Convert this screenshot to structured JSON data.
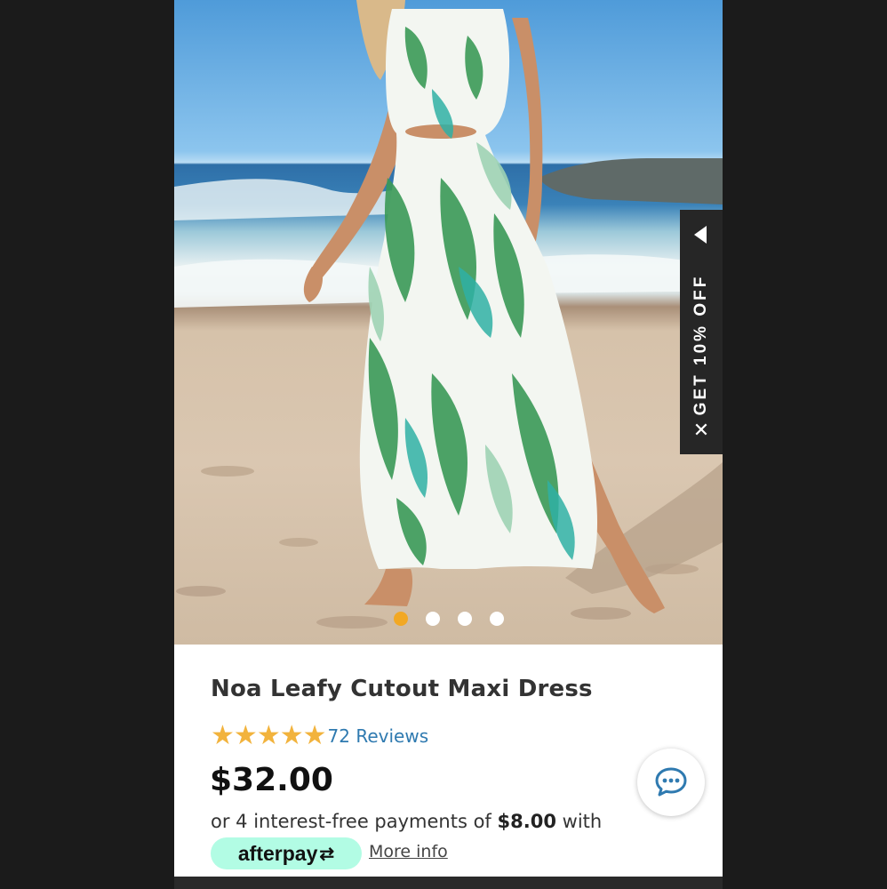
{
  "promo": {
    "label": "GET 10% OFF",
    "close_icon": "close-icon",
    "arrow_icon": "triangle-left-icon"
  },
  "gallery": {
    "total_images": 4,
    "active_index": 0,
    "accent_color": "#f2a824"
  },
  "product": {
    "title": "Noa Leafy Cutout Maxi Dress",
    "rating": 5,
    "reviews_label": "72 Reviews",
    "price": "$32.00",
    "installments": {
      "prefix": "or 4 interest-free payments of",
      "amount": "$8.00",
      "suffix": "with"
    },
    "afterpay": {
      "label": "afterpay",
      "logo_icon": "afterpay-arrows-icon",
      "color": "#b2fce4"
    },
    "more_info": "More info"
  },
  "chat": {
    "icon": "chat-bubble-icon",
    "color": "#2f7ab0"
  },
  "colors": {
    "star": "#f2b33d",
    "link": "#2f7ab0",
    "promo_bg": "#262626"
  }
}
